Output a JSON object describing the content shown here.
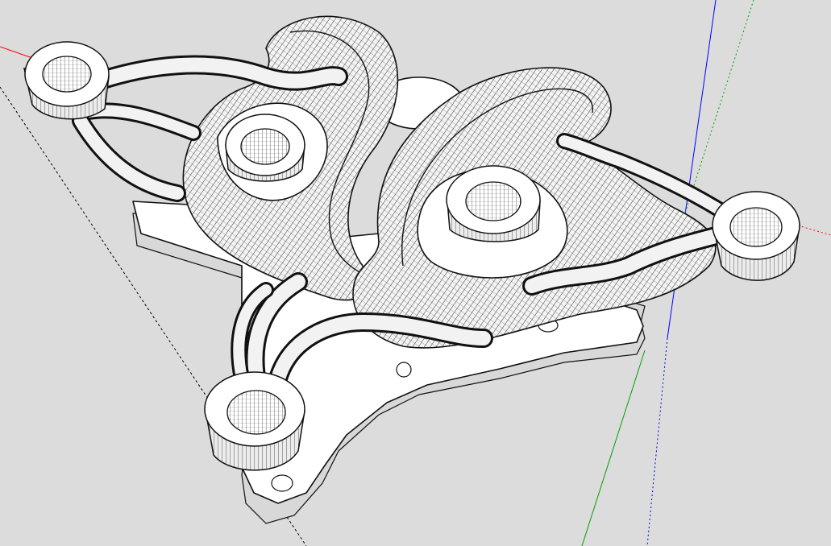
{
  "viewport": {
    "background": "#dcdcdc",
    "render_style": "wireframe-hidden-line"
  },
  "axes": {
    "red": "#ff0000",
    "green": "#00a000",
    "blue": "#0000ff",
    "inference": "#000000"
  },
  "model": {
    "line_color": "#111111",
    "face_color": "#ffffff",
    "shade_color": "#d8d8d8"
  }
}
